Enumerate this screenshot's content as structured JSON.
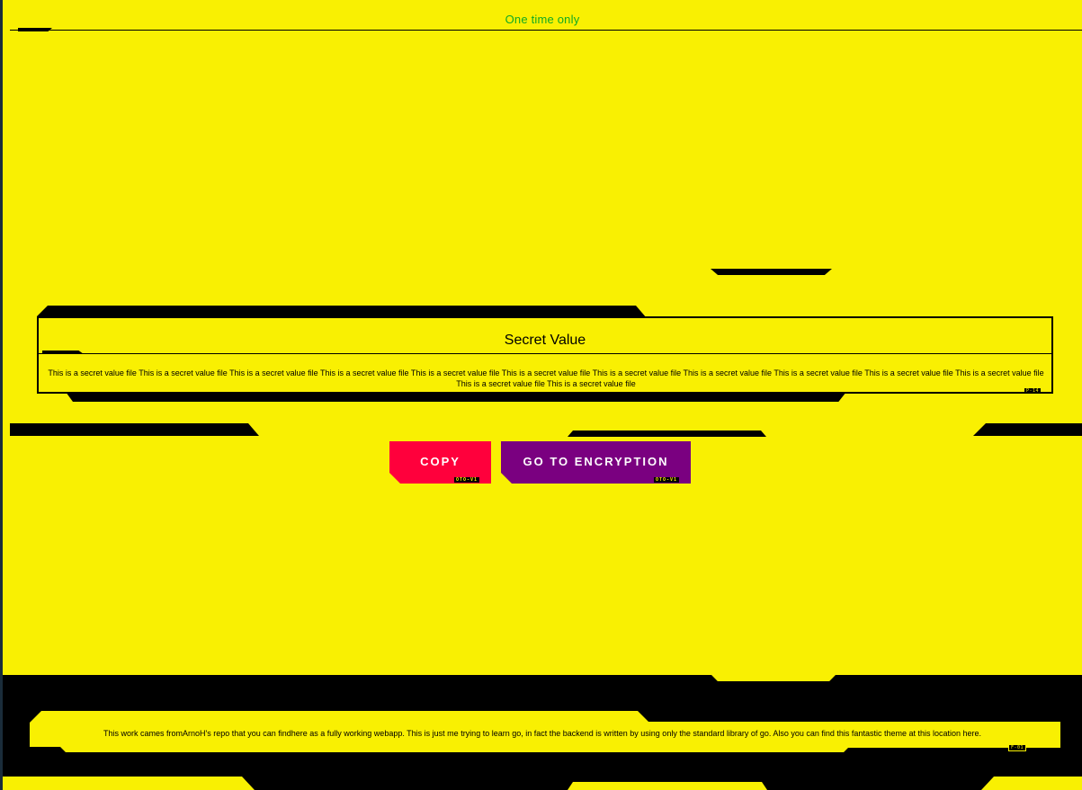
{
  "header": {
    "title": "One time only"
  },
  "secret": {
    "title": "Secret Value",
    "content": "This is a secret value file This is a secret value file This is a secret value file This is a secret value file This is a secret value file This is a secret value file This is a secret value file This is a secret value file This is a secret value file This is a secret value file This is a secret value file This is a secret value file This is a secret value file",
    "tag": "P-14"
  },
  "actions": {
    "copy_label": "COPY",
    "copy_tag": "OTO-V1",
    "encryption_label": "GO TO ENCRYPTION",
    "encryption_tag": "OTO-V1"
  },
  "footer": {
    "text_1": "This work cames from",
    "link_1": "ArnoH's repo",
    "text_2": " that you can find",
    "link_2": "here",
    "text_3": " as a fully working webapp. This is just me trying to learn go, in fact the backend is written by using only the standard library of go. Also you can find this fantastic theme at this location ",
    "link_3": "here",
    "text_4": ".",
    "tag": "F-01"
  },
  "colors": {
    "background": "#f9f002",
    "copy_button": "#ff003c",
    "encryption_button": "#7a0080",
    "title_text": "#11aa22",
    "footer": "#000000"
  }
}
